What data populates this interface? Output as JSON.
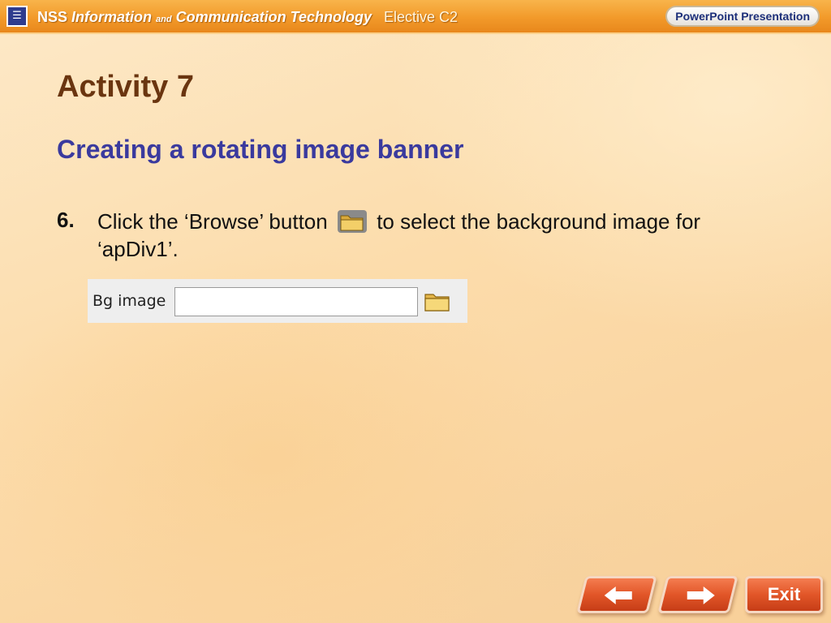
{
  "header": {
    "logo_glyph": "NSS",
    "title_nss": "NSS",
    "title_information": "Information",
    "title_and": "and",
    "title_communication_technology": "Communication Technology",
    "title_elective": "Elective C2",
    "powerpoint_label": "PowerPoint Presentation"
  },
  "content": {
    "title": "Activity 7",
    "subtitle": "Creating a rotating image banner",
    "step_number": "6.",
    "step_text_before": "Click the ‘Browse’ button",
    "step_text_after": "to select the background image for ‘apDiv1’."
  },
  "screenshot_panel": {
    "label": "Bg image",
    "input_value": "",
    "folder_icon": "folder-icon"
  },
  "nav": {
    "prev_icon": "arrow-left-icon",
    "next_icon": "arrow-right-icon",
    "exit_label": "Exit"
  },
  "colors": {
    "banner": "#f29a2a",
    "title": "#6a3510",
    "subtitle": "#3a3a9e",
    "nav_button": "#e25628"
  }
}
